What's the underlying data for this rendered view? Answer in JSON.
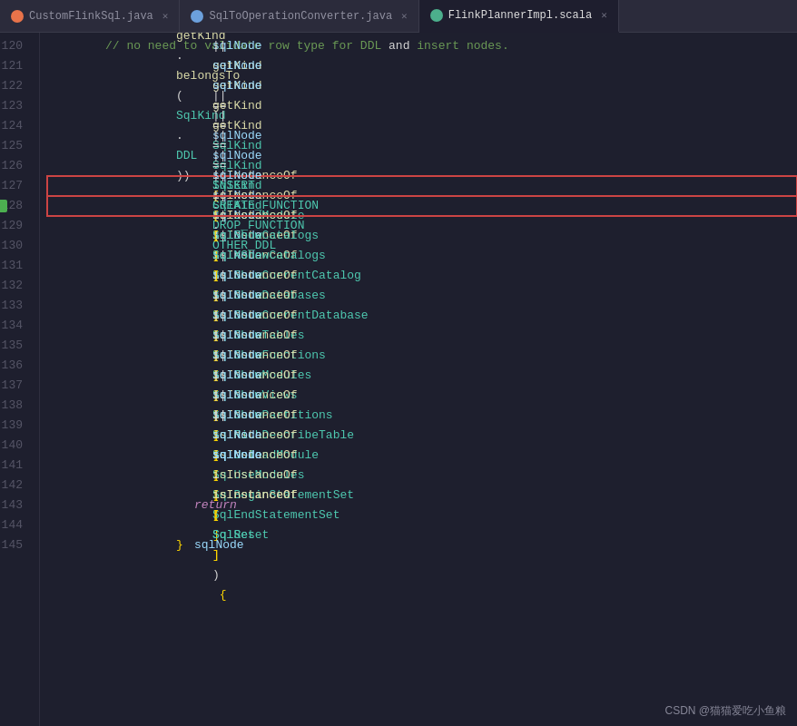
{
  "tabs": [
    {
      "id": "tab1",
      "label": "CustomFlinkSql.java",
      "color": "#e8734a",
      "active": false
    },
    {
      "id": "tab2",
      "label": "SqlToOperationConverter.java",
      "color": "#6ca0dc",
      "active": false
    },
    {
      "id": "tab3",
      "label": "FlinkPlannerImpl.scala",
      "color": "#4caf8c",
      "active": true
    }
  ],
  "watermark": "CSDN @猫猫爱吃小鱼粮",
  "lines": [
    {
      "num": 120,
      "marker": false,
      "highlighted": false
    },
    {
      "num": 121,
      "marker": false,
      "highlighted": false
    },
    {
      "num": 122,
      "marker": false,
      "highlighted": false
    },
    {
      "num": 123,
      "marker": false,
      "highlighted": false
    },
    {
      "num": 124,
      "marker": false,
      "highlighted": false
    },
    {
      "num": 125,
      "marker": false,
      "highlighted": false
    },
    {
      "num": 126,
      "marker": false,
      "highlighted": false
    },
    {
      "num": 127,
      "marker": false,
      "highlighted": true
    },
    {
      "num": 128,
      "marker": true,
      "highlighted": true
    },
    {
      "num": 129,
      "marker": false,
      "highlighted": false
    },
    {
      "num": 130,
      "marker": false,
      "highlighted": false
    },
    {
      "num": 131,
      "marker": false,
      "highlighted": false
    },
    {
      "num": 132,
      "marker": false,
      "highlighted": false
    },
    {
      "num": 133,
      "marker": false,
      "highlighted": false
    },
    {
      "num": 134,
      "marker": false,
      "highlighted": false
    },
    {
      "num": 135,
      "marker": false,
      "highlighted": false
    },
    {
      "num": 136,
      "marker": false,
      "highlighted": false
    },
    {
      "num": 137,
      "marker": false,
      "highlighted": false
    },
    {
      "num": 138,
      "marker": false,
      "highlighted": false
    },
    {
      "num": 139,
      "marker": false,
      "highlighted": false
    },
    {
      "num": 140,
      "marker": false,
      "highlighted": false
    },
    {
      "num": 141,
      "marker": false,
      "highlighted": false
    },
    {
      "num": 142,
      "marker": false,
      "highlighted": false
    },
    {
      "num": 143,
      "marker": false,
      "highlighted": false
    },
    {
      "num": 144,
      "marker": false,
      "highlighted": false
    },
    {
      "num": 145,
      "marker": false,
      "highlighted": false
    }
  ]
}
